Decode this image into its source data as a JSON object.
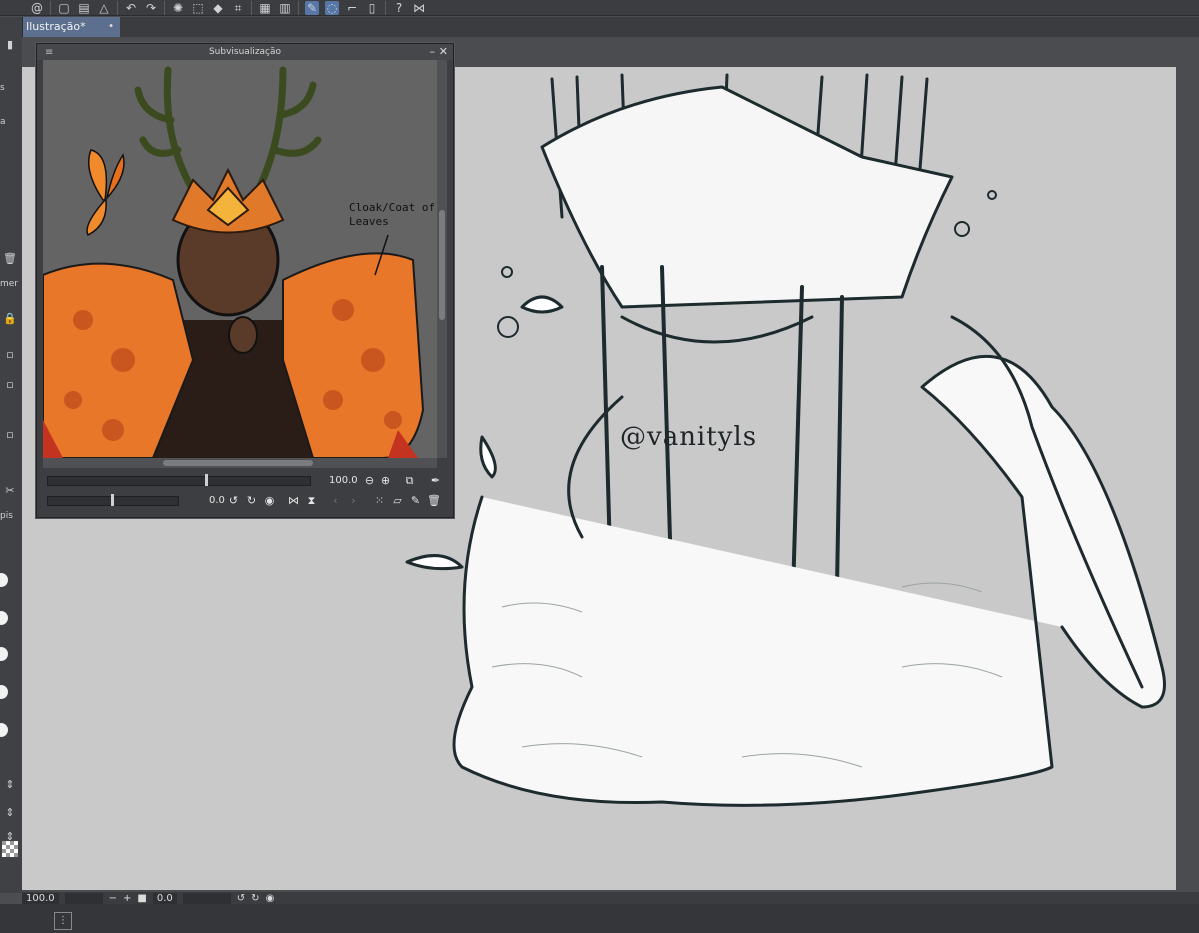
{
  "document": {
    "tab_title": "Ilustração*",
    "tab_dot": "•"
  },
  "subview": {
    "title": "Subvisualização",
    "zoom_value": "100.0",
    "rotation_value": "0.0",
    "annotation_text": "Cloak/Coat of\nLeaves"
  },
  "status": {
    "zoom": "100.0",
    "angle": "0.0"
  },
  "artwork": {
    "watermark": "@vanityls"
  },
  "left_panel_fragments": [
    "s",
    "a",
    "mer",
    "pis"
  ],
  "colors": {
    "ui_dark": "#3b3d40",
    "canvas_paper": "#c9c9c9",
    "tab_active": "#5d6f8f",
    "accent": "#5677a8",
    "cloak_orange": "#e8772a"
  },
  "icons": [
    "spiral-icon",
    "new-icon",
    "open-icon",
    "save-icon",
    "undo-icon",
    "redo-icon",
    "loading-icon",
    "selection-icon",
    "fill-icon",
    "transform-icon",
    "pen-icon",
    "close-icon",
    "minimize-icon",
    "zoom-out-icon",
    "zoom-in-icon",
    "eyedropper-icon",
    "rotate-left-icon",
    "rotate-right-icon",
    "reset-icon",
    "flip-icon",
    "trash-icon"
  ]
}
